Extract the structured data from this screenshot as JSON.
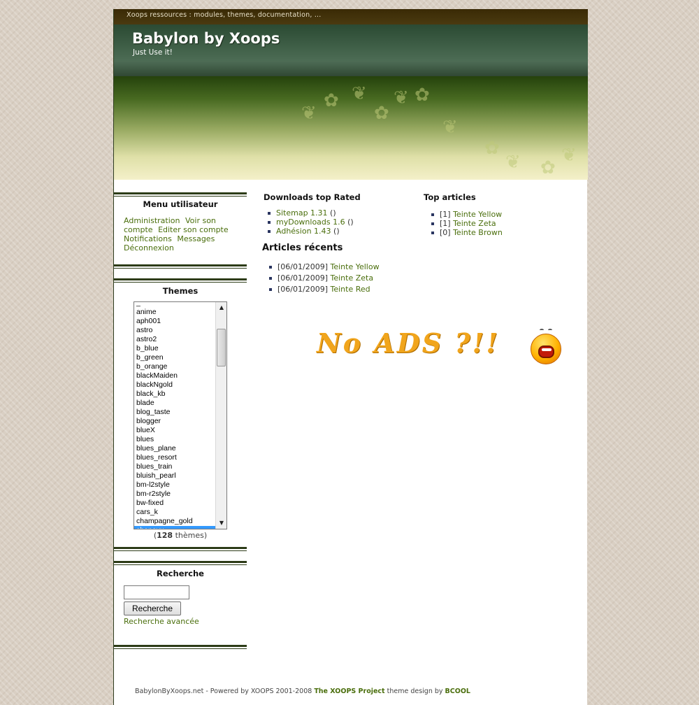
{
  "topbar": {
    "text": "Xoops ressources : modules, themes, documentation, ..."
  },
  "header": {
    "title": "Babylon by Xoops",
    "slogan": "Just Use it!"
  },
  "user_menu": {
    "title": "Menu utilisateur",
    "links": [
      "Administration",
      "Voir son compte",
      "Editer son compte",
      "Notifications",
      "Messages",
      "Déconnexion"
    ]
  },
  "themes": {
    "title": "Themes",
    "items": [
      "_",
      "anime",
      "aph001",
      "astro",
      "astro2",
      "b_blue",
      "b_green",
      "b_orange",
      "blackMaiden",
      "blackNgold",
      "black_kb",
      "blade",
      "blog_taste",
      "blogger",
      "blueX",
      "blues",
      "blues_plane",
      "blues_resort",
      "blues_train",
      "bluish_pearl",
      "bm-l2style",
      "bm-r2style",
      "bw-fixed",
      "cars_k",
      "champagne_gold",
      "chanoyu"
    ],
    "selected": "chanoyu",
    "count_open": "(",
    "count": "128",
    "count_suffix": " thèmes)"
  },
  "search": {
    "title": "Recherche",
    "input_value": "",
    "button_label": "Recherche",
    "advanced_link": "Recherche avancée"
  },
  "downloads": {
    "title": "Downloads top Rated",
    "items": [
      {
        "label": "Sitemap 1.31",
        "suffix": " ()"
      },
      {
        "label": "myDownloads 1.6",
        "suffix": " ()"
      },
      {
        "label": "Adhésion 1.43",
        "suffix": " ()"
      }
    ]
  },
  "top_articles": {
    "title": "Top articles",
    "items": [
      {
        "prefix": "[1] ",
        "label": "Teinte Yellow"
      },
      {
        "prefix": "[1] ",
        "label": "Teinte Zeta"
      },
      {
        "prefix": "[0] ",
        "label": "Teinte Brown"
      }
    ]
  },
  "recent_articles": {
    "title": "Articles récents",
    "items": [
      {
        "date": "[06/01/2009] ",
        "label": "Teinte Yellow"
      },
      {
        "date": "[06/01/2009] ",
        "label": "Teinte Zeta"
      },
      {
        "date": "[06/01/2009] ",
        "label": "Teinte Red"
      }
    ]
  },
  "ad": {
    "text": "No ADS ?!!"
  },
  "footer": {
    "text": "BabylonByXoops.net - Powered by XOOPS 2001-2008 ",
    "project_link": "The XOOPS Project",
    "design_text": " theme design by ",
    "designer_link": "BCOOL"
  },
  "colors": {
    "link": "#4a6e0c",
    "header_dark": "#2b4a33",
    "selected": "#3399ff"
  }
}
